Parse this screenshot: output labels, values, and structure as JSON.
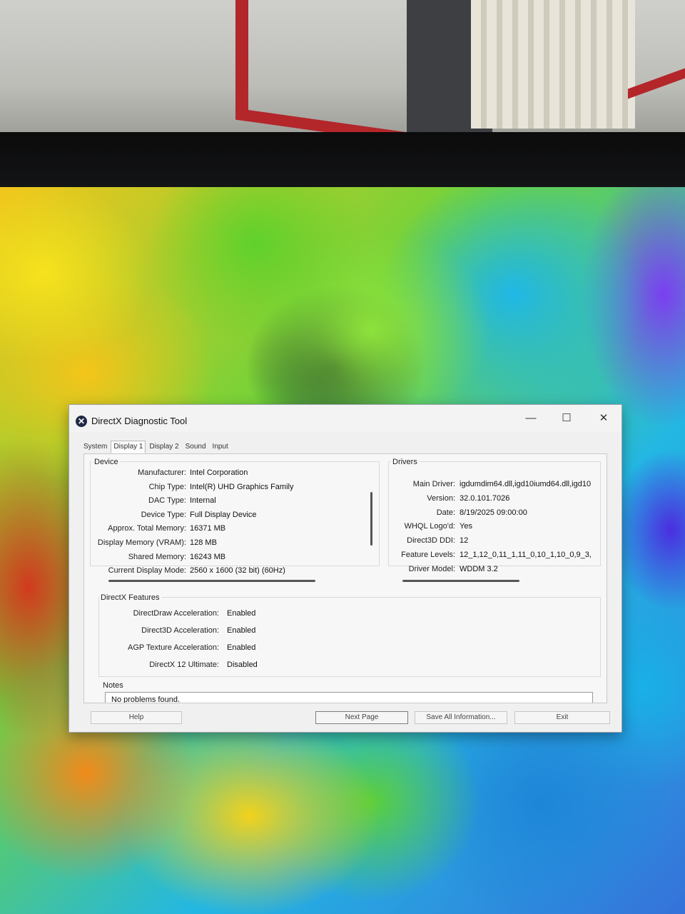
{
  "window": {
    "title": "DirectX Diagnostic Tool",
    "minimize_glyph": "—",
    "maximize_glyph": "☐",
    "close_glyph": "✕",
    "app_icon_glyph": "✕"
  },
  "tabs": [
    {
      "label": "System",
      "active": false
    },
    {
      "label": "Display 1",
      "active": true
    },
    {
      "label": "Display 2",
      "active": false
    },
    {
      "label": "Sound",
      "active": false
    },
    {
      "label": "Input",
      "active": false
    }
  ],
  "device": {
    "title": "Device",
    "rows": [
      {
        "label": "Manufacturer:",
        "value": "Intel Corporation"
      },
      {
        "label": "Chip Type:",
        "value": "Intel(R) UHD Graphics Family"
      },
      {
        "label": "DAC Type:",
        "value": "Internal"
      },
      {
        "label": "Device Type:",
        "value": "Full Display Device"
      },
      {
        "label": "Approx. Total Memory:",
        "value": "16371 MB"
      },
      {
        "label": "Display Memory (VRAM):",
        "value": "128 MB"
      },
      {
        "label": "Shared Memory:",
        "value": "16243 MB"
      },
      {
        "label": "Current Display Mode:",
        "value": "2560 x 1600 (32 bit) (60Hz)"
      }
    ]
  },
  "drivers": {
    "title": "Drivers",
    "rows": [
      {
        "label": "Main Driver:",
        "value": "igdumdim64.dll,igd10iumd64.dll,igd10"
      },
      {
        "label": "Version:",
        "value": "32.0.101.7026"
      },
      {
        "label": "Date:",
        "value": "8/19/2025 09:00:00"
      },
      {
        "label": "WHQL Logo'd:",
        "value": "Yes"
      },
      {
        "label": "Direct3D DDI:",
        "value": "12"
      },
      {
        "label": "Feature Levels:",
        "value": "12_1,12_0,11_1,11_0,10_1,10_0,9_3,"
      },
      {
        "label": "Driver Model:",
        "value": "WDDM 3.2"
      }
    ]
  },
  "features": {
    "title": "DirectX Features",
    "rows": [
      {
        "label": "DirectDraw Acceleration:",
        "value": "Enabled"
      },
      {
        "label": "Direct3D Acceleration:",
        "value": "Enabled"
      },
      {
        "label": "AGP Texture Acceleration:",
        "value": "Enabled"
      },
      {
        "label": "DirectX 12 Ultimate:",
        "value": "Disabled"
      }
    ]
  },
  "notes": {
    "title": "Notes",
    "text": "No problems found."
  },
  "buttons": {
    "help": "Help",
    "next_page": "Next Page",
    "save_all": "Save All Information...",
    "exit": "Exit"
  }
}
